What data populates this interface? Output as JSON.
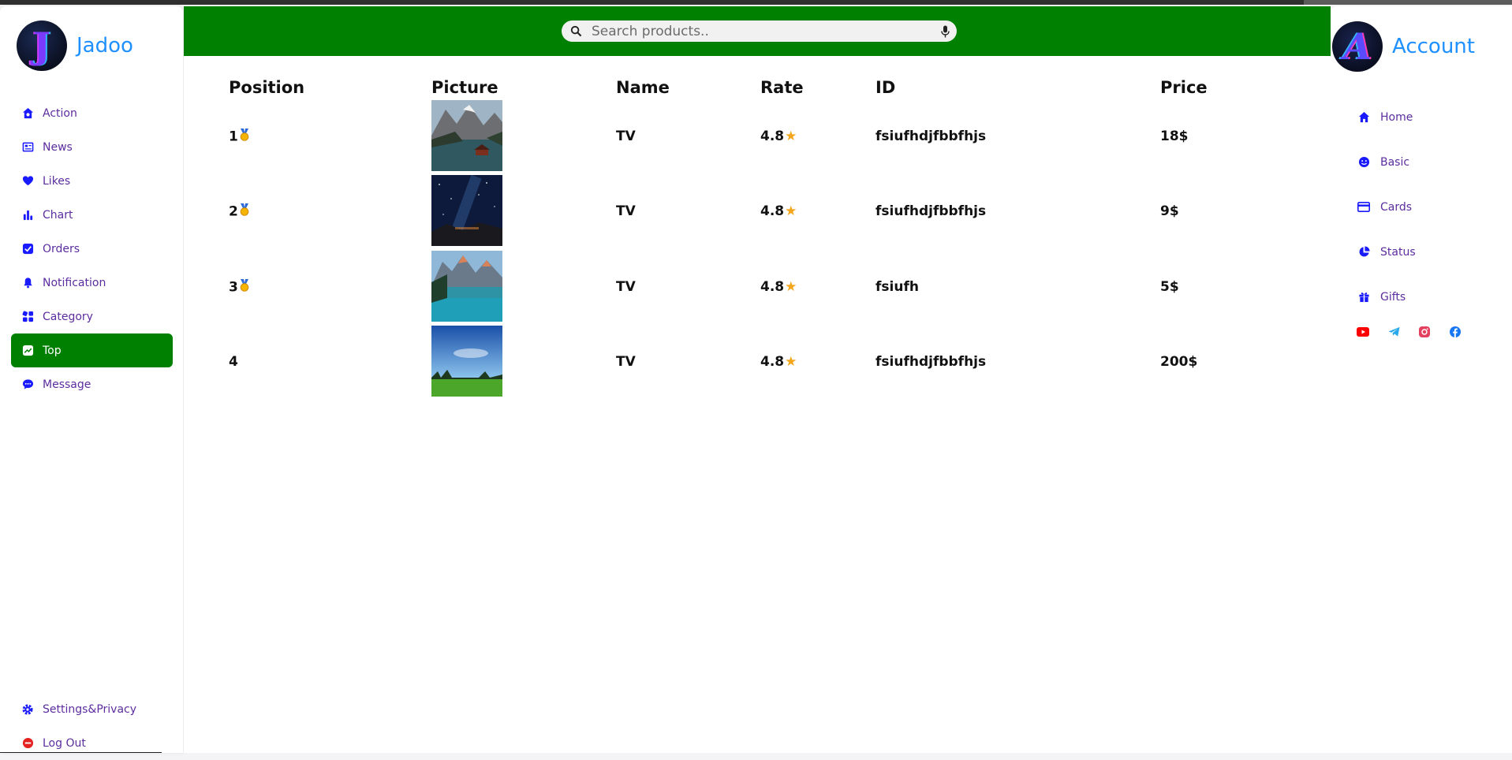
{
  "brand": {
    "name": "Jadoo",
    "logo_letter": "J"
  },
  "sidebar": {
    "items": [
      {
        "label": "Action",
        "icon": "home-gear-icon"
      },
      {
        "label": "News",
        "icon": "news-icon"
      },
      {
        "label": "Likes",
        "icon": "heart-icon"
      },
      {
        "label": "Chart",
        "icon": "bar-chart-icon"
      },
      {
        "label": "Orders",
        "icon": "check-square-icon"
      },
      {
        "label": "Notification",
        "icon": "bell-icon"
      },
      {
        "label": "Category",
        "icon": "category-grid-icon"
      },
      {
        "label": "Top",
        "icon": "trending-icon",
        "active": true
      },
      {
        "label": "Message",
        "icon": "chat-bubble-icon"
      }
    ],
    "bottom": [
      {
        "label": "Settings&Privacy",
        "icon": "gear-icon"
      },
      {
        "label": "Log Out",
        "icon": "logout-icon"
      }
    ]
  },
  "search": {
    "placeholder": "Search products.."
  },
  "table": {
    "headers": [
      "Position",
      "Picture",
      "Name",
      "Rate",
      "ID",
      "Price"
    ],
    "rows": [
      {
        "position": "1",
        "medal": true,
        "name": "TV",
        "rate": "4.8",
        "id": "fsiufhdjfbbfhjs",
        "price": "18$",
        "picture": "mountain-lake-cabin"
      },
      {
        "position": "2",
        "medal": true,
        "name": "TV",
        "rate": "4.8",
        "id": "fsiufhdjfbbfhjs",
        "price": "9$",
        "picture": "starry-night-sky"
      },
      {
        "position": "3",
        "medal": true,
        "name": "TV",
        "rate": "4.8",
        "id": "fsiufh",
        "price": "5$",
        "picture": "turquoise-mountain-lake"
      },
      {
        "position": "4",
        "medal": false,
        "name": "TV",
        "rate": "4.8",
        "id": "fsiufhdjfbbfhjs",
        "price": "200$",
        "picture": "green-meadow-blue-sky"
      }
    ]
  },
  "account": {
    "title": "Account",
    "logo_letter": "A",
    "items": [
      {
        "label": "Home",
        "icon": "home-icon"
      },
      {
        "label": "Basic",
        "icon": "smile-icon"
      },
      {
        "label": "Cards",
        "icon": "credit-card-icon"
      },
      {
        "label": "Status",
        "icon": "pie-chart-icon"
      },
      {
        "label": "Gifts",
        "icon": "gift-icon"
      }
    ],
    "social": [
      {
        "icon": "youtube-icon",
        "color": "#ff0000"
      },
      {
        "icon": "telegram-icon",
        "color": "#29a9eb"
      },
      {
        "icon": "instagram-icon",
        "color": "#e4405f"
      },
      {
        "icon": "facebook-icon",
        "color": "#1877f2"
      }
    ]
  },
  "colors": {
    "header_green": "#008000",
    "brand_blue": "#1e90ff",
    "nav_text": "#5b2d9e",
    "icon_blue": "#1a1aff",
    "star": "#f3a51b"
  }
}
